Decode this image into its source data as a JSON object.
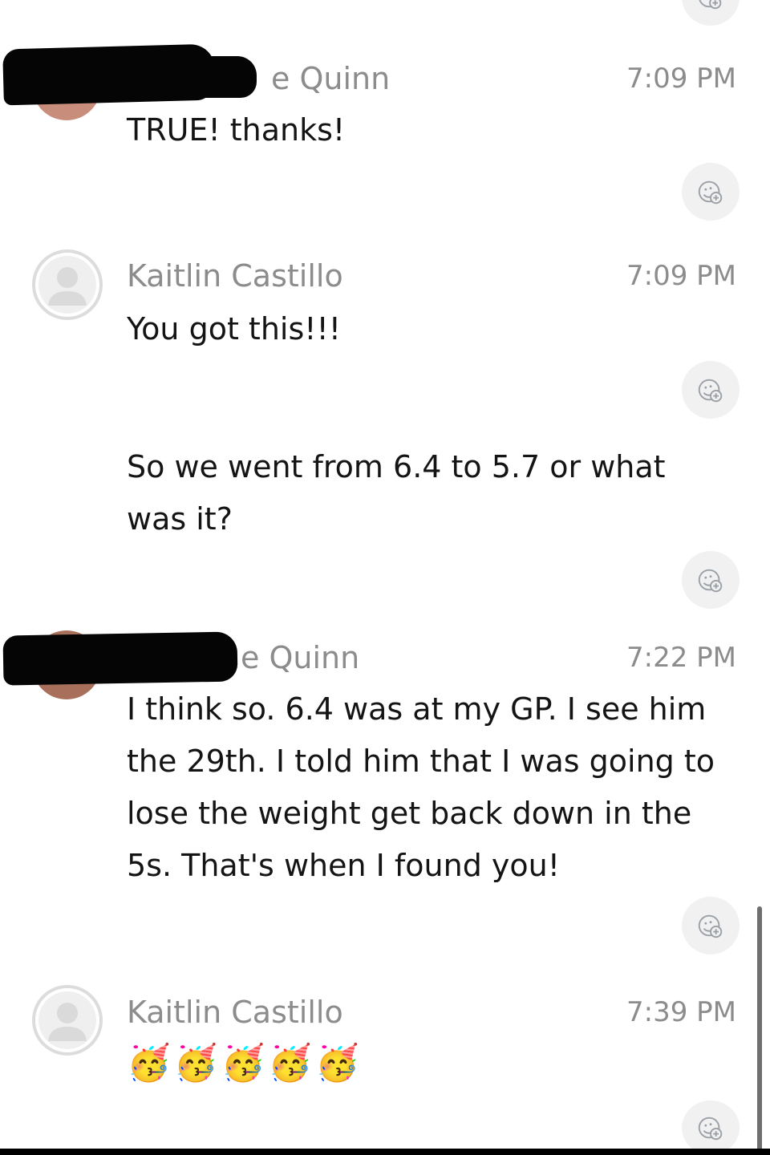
{
  "messages": [
    {
      "sender": "e Quinn",
      "time": "7:09 PM",
      "text": "TRUE! thanks!"
    },
    {
      "sender": "Kaitlin Castillo",
      "time": "7:09 PM",
      "text": "You got this!!!",
      "text2": "So we went from 6.4 to 5.7 or what was it?"
    },
    {
      "sender": "e Quinn",
      "time": "7:22 PM",
      "text": "I think so. 6.4 was at my GP. I see him the 29th. I told him that I was going to lose the weight get back down in the 5s. That's when I found you!"
    },
    {
      "sender": "Kaitlin Castillo",
      "time": "7:39 PM",
      "text": "🥳🥳🥳🥳🥳"
    }
  ],
  "icons": {
    "reaction": "add-reaction-icon",
    "avatar_placeholder": "person-placeholder-icon"
  },
  "colors": {
    "name_gray": "#8c8c8c",
    "text": "#141414",
    "bubble_bg": "#f1f1f1"
  }
}
